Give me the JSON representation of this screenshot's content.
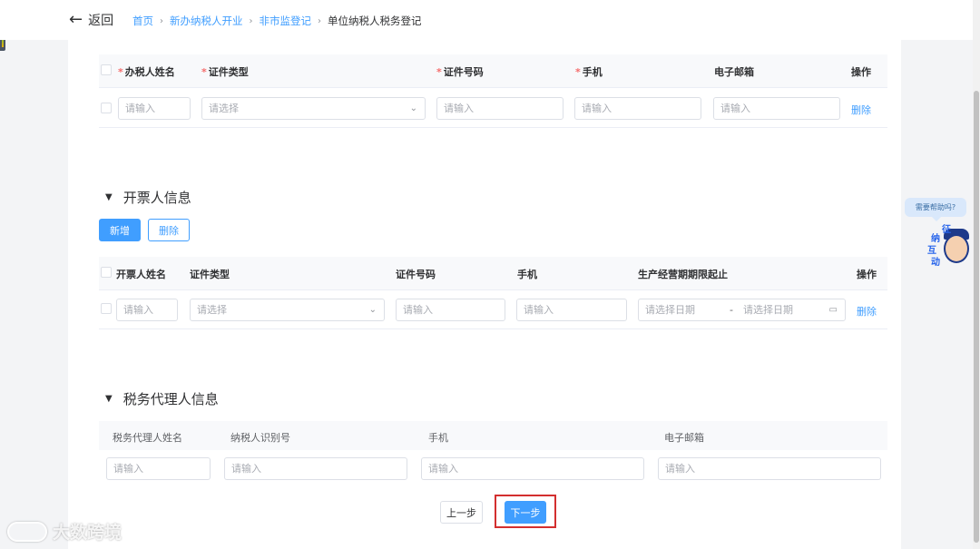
{
  "nav": {
    "back_label": "返回",
    "breadcrumb": [
      "首页",
      "新办纳税人开业",
      "非市监登记",
      "单位纳税人税务登记"
    ]
  },
  "section1": {
    "headers": [
      "办税人姓名",
      "证件类型",
      "证件号码",
      "手机",
      "电子邮箱",
      "操作"
    ],
    "required": [
      true,
      true,
      true,
      true,
      false,
      false
    ],
    "row": {
      "name_placeholder": "请输入",
      "idtype_placeholder": "请选择",
      "idno_placeholder": "请输入",
      "phone_placeholder": "请输入",
      "email_placeholder": "请输入",
      "delete_label": "删除"
    }
  },
  "section2": {
    "title": "开票人信息",
    "add_label": "新增",
    "delete_btn_label": "删除",
    "headers": [
      "开票人姓名",
      "证件类型",
      "证件号码",
      "手机",
      "生产经营期期限起止",
      "操作"
    ],
    "row": {
      "name_placeholder": "请输入",
      "idtype_placeholder": "请选择",
      "idno_placeholder": "请输入",
      "phone_placeholder": "请输入",
      "start_date_placeholder": "请选择日期",
      "range_sep": "-",
      "end_date_placeholder": "请选择日期",
      "delete_label": "删除"
    }
  },
  "section3": {
    "title": "税务代理人信息",
    "headers": [
      "税务代理人姓名",
      "纳税人识别号",
      "手机",
      "电子邮箱"
    ],
    "row": {
      "name_placeholder": "请输入",
      "taxid_placeholder": "请输入",
      "phone_placeholder": "请输入",
      "email_placeholder": "请输入"
    }
  },
  "footer": {
    "prev_label": "上一步",
    "next_label": "下一步"
  },
  "help": {
    "bubble_text": "需要帮助吗?",
    "mascot_chars": [
      "征",
      "纳",
      "互",
      "动"
    ]
  },
  "watermark": "大数跨境",
  "colors": {
    "primary": "#409eff",
    "required": "#f56c6c",
    "highlight_box": "#d32f2f"
  }
}
